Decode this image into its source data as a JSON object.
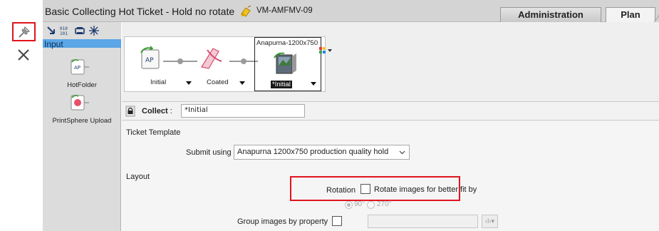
{
  "window": {
    "title": "Basic Collecting Hot Ticket - Hold no rotate",
    "printer_name": "VM-AMFMV-09"
  },
  "tabs": [
    {
      "label": "Administration",
      "active": false
    },
    {
      "label": "Plan",
      "active": true
    }
  ],
  "toolstrip": {
    "pin_icon": "pushpin-icon",
    "close_icon": "close-icon"
  },
  "left_panel": {
    "toolbar_icons": [
      "connector-icon",
      "binary-icon",
      "printer-icon",
      "sparkle-icon"
    ],
    "section_label": "Input",
    "sources": [
      {
        "label": "HotFolder",
        "icon": "hotfolder-icon"
      },
      {
        "label": "PrintSphere Upload",
        "icon": "printsphere-icon"
      }
    ]
  },
  "flow": {
    "nodes": [
      {
        "label": "Initial",
        "icon": "hotfolder-node-icon"
      },
      {
        "label": "Coated",
        "icon": "media-node-icon"
      },
      {
        "label": "*Initial",
        "icon": "device-node-icon",
        "selected": true,
        "device": "Anapurna-1200x750"
      }
    ],
    "colors_icon": "color-swatch-icon"
  },
  "collect": {
    "label": "Collect",
    "separator": ":",
    "value": "*Initial"
  },
  "ticket_template": {
    "heading": "Ticket Template",
    "submit_label": "Submit using",
    "submit_value": "Anapurna 1200x750 production quality hold"
  },
  "layout": {
    "heading": "Layout",
    "rotation_label": "Rotation",
    "rotate_checkbox_label": "Rotate images for better fit by",
    "rotate_checked": false,
    "angle_options": [
      {
        "label": "90°",
        "selected": true
      },
      {
        "label": "270°",
        "selected": false
      }
    ],
    "group_label": "Group images by property",
    "group_checked": false,
    "insert_button": "‹I›▾"
  },
  "colors": {
    "highlight_red": "#e0141e",
    "input_header_blue": "#5aa6e6"
  }
}
